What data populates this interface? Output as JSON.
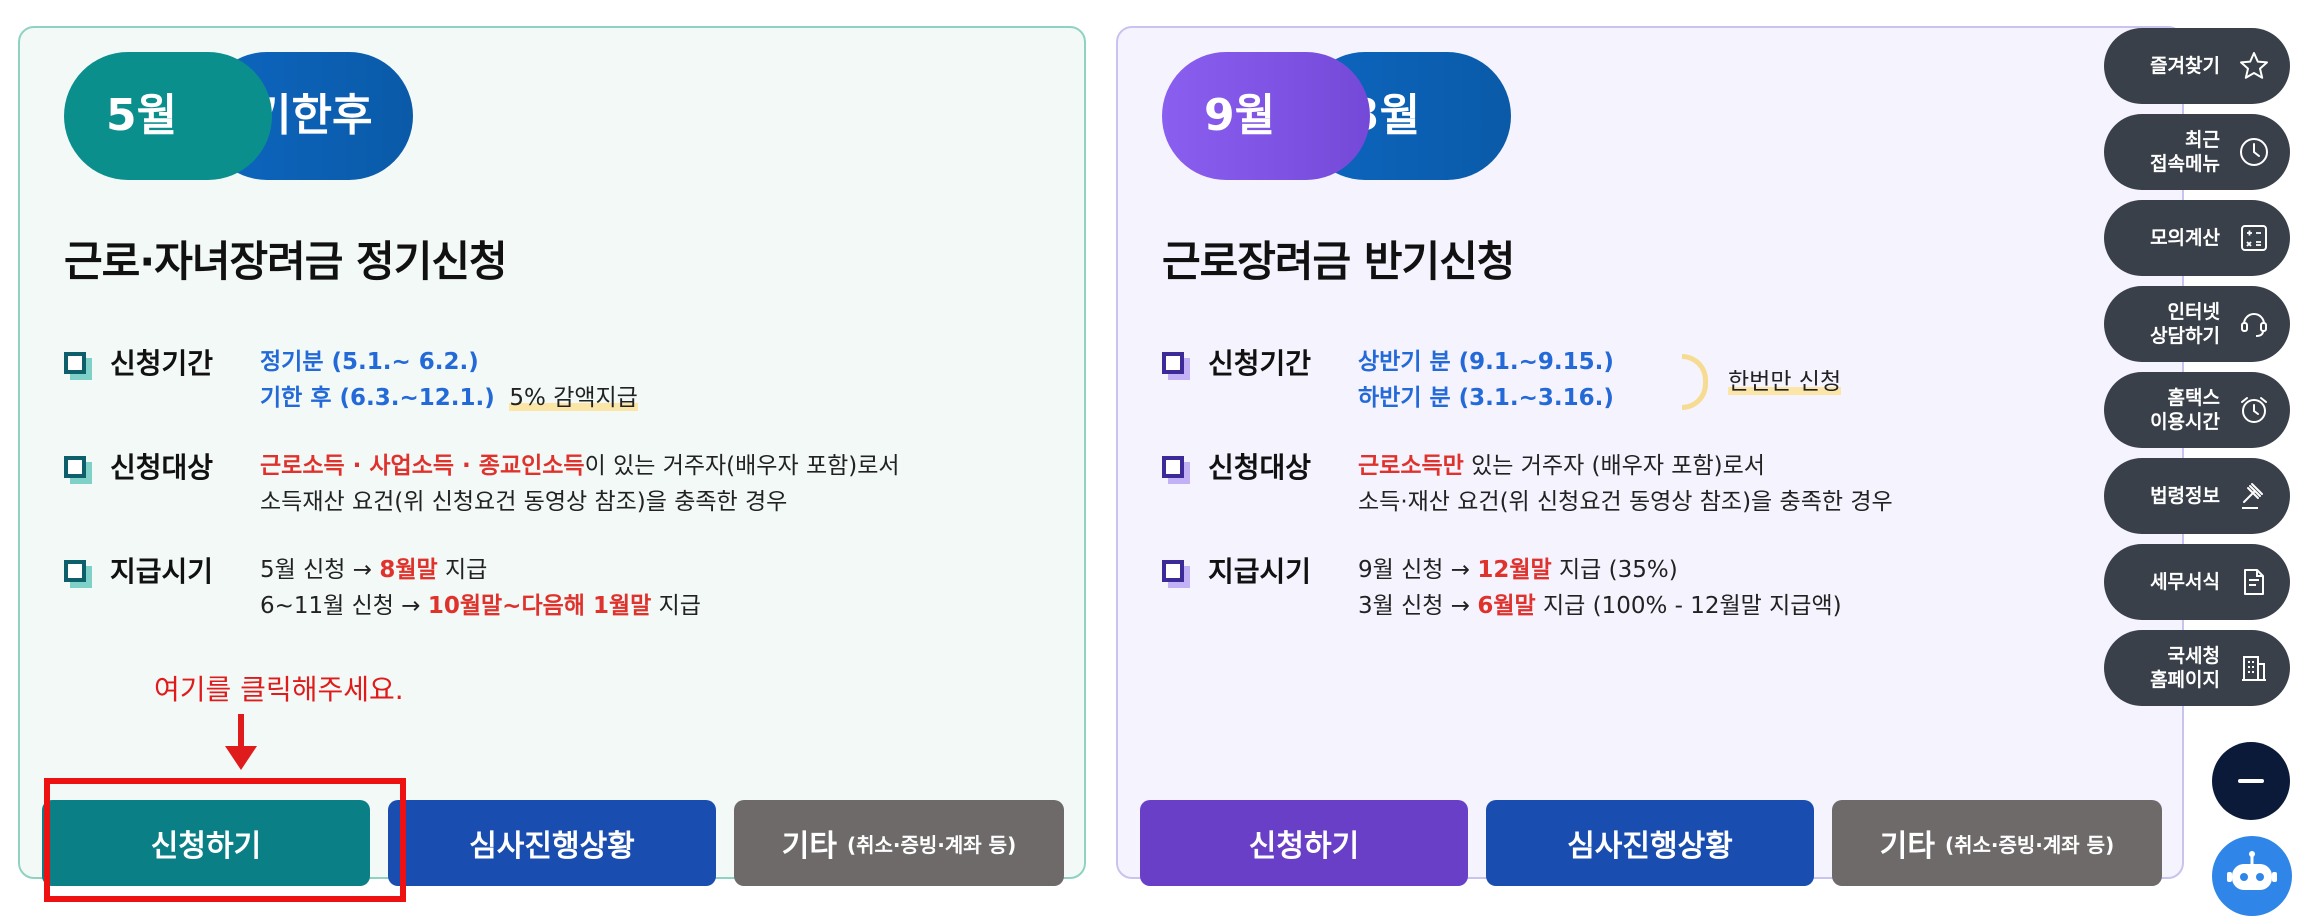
{
  "left_card": {
    "pill_a": "5월",
    "pill_b": "기한후",
    "title": "근로·자녀장려금 정기신청",
    "rows": [
      {
        "label": "신청기간",
        "lines": [
          [
            "정기분 (5.1.~ 6.2.)"
          ],
          [
            "기한 후 (6.3.~12.1.)",
            "5% 감액지급"
          ]
        ]
      },
      {
        "label": "신청대상",
        "lines": [
          [
            "근로소득 · 사업소득 · 종교인소득",
            "이 있는 거주자(배우자 포함)로서"
          ],
          [
            "소득재산 요건(위 신청요건 동영상 참조)을 충족한 경우"
          ]
        ]
      },
      {
        "label": "지급시기",
        "lines": [
          [
            "5월 신청 → ",
            "8월말",
            " 지급"
          ],
          [
            "6~11월 신청 → ",
            "10월말~다음해 1월말",
            " 지급"
          ]
        ]
      }
    ],
    "annotation": "여기를 클릭해주세요.",
    "buttons": {
      "apply": "신청하기",
      "status": "심사진행상황",
      "other": "기타",
      "other_sub": "(취소·증빙·계좌 등)"
    }
  },
  "right_card": {
    "pill_a": "9월",
    "pill_b": "3월",
    "title": "근로장려금 반기신청",
    "rows": [
      {
        "label": "신청기간",
        "lines": [
          [
            "상반기 분 (9.1.~9.15.)"
          ],
          [
            "하반기 분 (3.1.~3.16.)"
          ]
        ],
        "side_note": "한번만 신청"
      },
      {
        "label": "신청대상",
        "lines": [
          [
            "근로소득만",
            " 있는 거주자 (배우자 포함)로서"
          ],
          [
            "소득·재산 요건(위 신청요건 동영상 참조)을 충족한 경우"
          ]
        ]
      },
      {
        "label": "지급시기",
        "lines": [
          [
            "9월 신청 → ",
            "12월말",
            " 지급 (35%)"
          ],
          [
            "3월 신청 → ",
            "6월말",
            " 지급 (100% - 12월말 지급액)"
          ]
        ]
      }
    ],
    "buttons": {
      "apply": "신청하기",
      "status": "심사진행상황",
      "other": "기타",
      "other_sub": "(취소·증빙·계좌 등)"
    }
  },
  "quick_menu": [
    {
      "label": "즐겨찾기",
      "icon": "star-icon"
    },
    {
      "label": "최근\n접속메뉴",
      "icon": "clock-icon"
    },
    {
      "label": "모의계산",
      "icon": "calculator-icon"
    },
    {
      "label": "인터넷\n상담하기",
      "icon": "chat-icon"
    },
    {
      "label": "홈택스\n이용시간",
      "icon": "alarm-icon"
    },
    {
      "label": "법령정보",
      "icon": "gavel-icon"
    },
    {
      "label": "세무서식",
      "icon": "document-icon"
    },
    {
      "label": "국세청\n홈페이지",
      "icon": "building-icon"
    }
  ],
  "colors": {
    "left_apply": "#0a7f86",
    "right_apply": "#6a3fc8",
    "status": "#1a4db0",
    "other": "#6e6a6a",
    "highlight": "#ee1111"
  }
}
